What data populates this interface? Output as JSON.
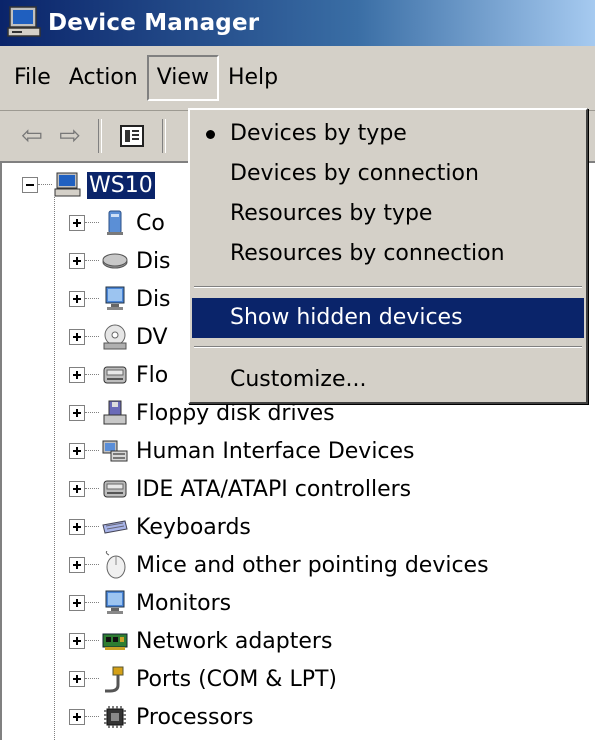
{
  "window": {
    "title": "Device Manager"
  },
  "menubar": {
    "items": [
      "File",
      "Action",
      "View",
      "Help"
    ]
  },
  "toolbar": {
    "back": "⇦",
    "forward": "⇨"
  },
  "view_menu": {
    "items": [
      {
        "label": "Devices by type",
        "checked": true
      },
      {
        "label": "Devices by connection"
      },
      {
        "label": "Resources by type"
      },
      {
        "label": "Resources by connection"
      },
      {
        "label": "Show hidden devices",
        "highlighted": true
      },
      {
        "label": "Customize..."
      }
    ]
  },
  "tree": {
    "root": "WS10",
    "items": [
      "Co",
      "Dis",
      "Dis",
      "DV",
      "Flo",
      "Floppy disk drives",
      "Human Interface Devices",
      "IDE ATA/ATAPI controllers",
      "Keyboards",
      "Mice and other pointing devices",
      "Monitors",
      "Network adapters",
      "Ports (COM & LPT)",
      "Processors"
    ],
    "icons": [
      "computer-icon",
      "disk-drive-icon",
      "display-adapter-icon",
      "dvd-drive-icon",
      "floppy-controller-icon",
      "floppy-drive-icon",
      "hid-icon",
      "ide-controller-icon",
      "keyboard-icon",
      "mouse-icon",
      "monitor-icon",
      "network-adapter-icon",
      "port-icon",
      "processor-icon"
    ]
  },
  "colors": {
    "menu_highlight": "#0a246a",
    "chrome": "#d4d0c8"
  }
}
